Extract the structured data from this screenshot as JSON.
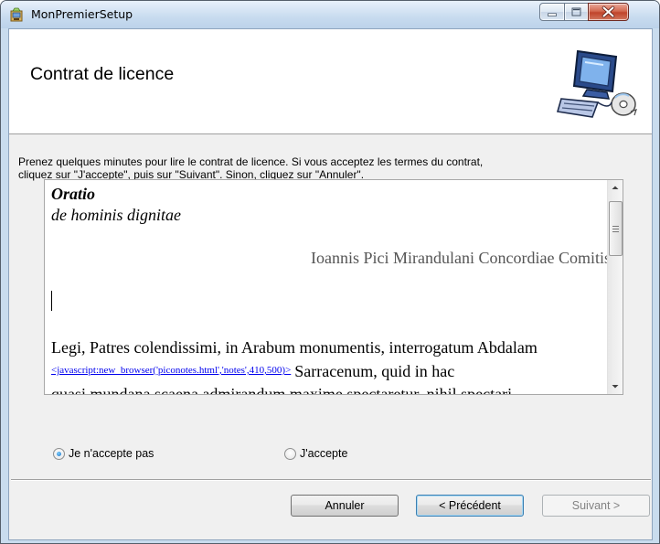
{
  "window": {
    "title": "MonPremierSetup",
    "controls": {
      "minimize": "minimize",
      "maximize": "maximize",
      "close": "close"
    }
  },
  "header": {
    "title": "Contrat de licence",
    "graphic": "computer-setup-icon"
  },
  "intro": {
    "text_line1": "Prenez quelques minutes pour lire le contrat de licence. Si vous acceptez les termes du contrat,",
    "text_line2": "cliquez sur \"J'accepte\", puis sur \"Suivant\". Sinon, cliquez sur \"Annuler\"."
  },
  "license": {
    "title": "Oratio",
    "subtitle": "de hominis dignitae",
    "author": "Ioannis Pici Mirandulani Concordiae Comitis",
    "para_line1": "Legi, Patres colendissimi, in Arabum monumentis, interrogatum Abdalam",
    "link": "<javascript:new_browser('piconotes.html','notes',410,500)>",
    "para_line2": "Sarracenum, quid in hac",
    "para_line3": "quasi mundana scaena admirandum maxime spectaretur, nihil spectari"
  },
  "options": {
    "decline": {
      "label": "Je n'accepte pas",
      "selected": true
    },
    "accept": {
      "label": "J'accepte",
      "selected": false
    }
  },
  "buttons": {
    "cancel": "Annuler",
    "previous": "< Précédent",
    "next": "Suivant >"
  },
  "colors": {
    "accent": "#3c7fb1",
    "link": "#0000ee",
    "close_button": "#c0442b"
  }
}
